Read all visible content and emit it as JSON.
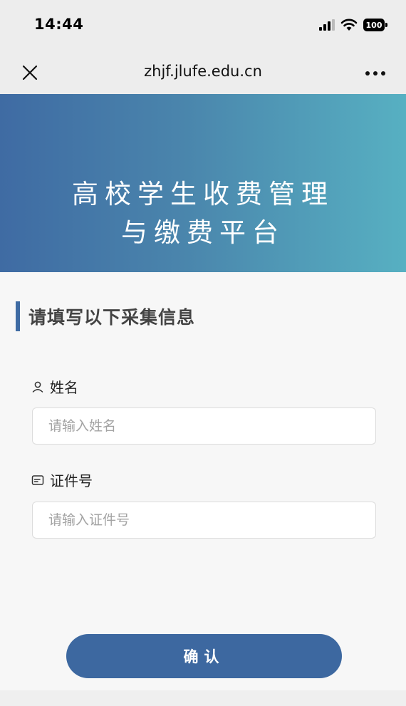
{
  "status_bar": {
    "time": "14:44",
    "battery": "100"
  },
  "nav": {
    "url": "zhjf.jlufe.edu.cn",
    "close_icon": "close-icon",
    "more_icon": "more-icon"
  },
  "banner": {
    "title_line1": "高校学生收费管理",
    "title_line2": "与缴费平台",
    "gradient_start": "#3f6ba3",
    "gradient_end": "#57b0c2"
  },
  "form": {
    "section_title": "请填写以下采集信息",
    "name_field": {
      "label": "姓名",
      "icon": "person-icon",
      "placeholder": "请输入姓名",
      "value": ""
    },
    "id_field": {
      "label": "证件号",
      "icon": "id-card-icon",
      "placeholder": "请输入证件号",
      "value": ""
    },
    "confirm_label": "确认"
  },
  "colors": {
    "accent": "#3d68a0",
    "background": "#f7f7f7"
  }
}
